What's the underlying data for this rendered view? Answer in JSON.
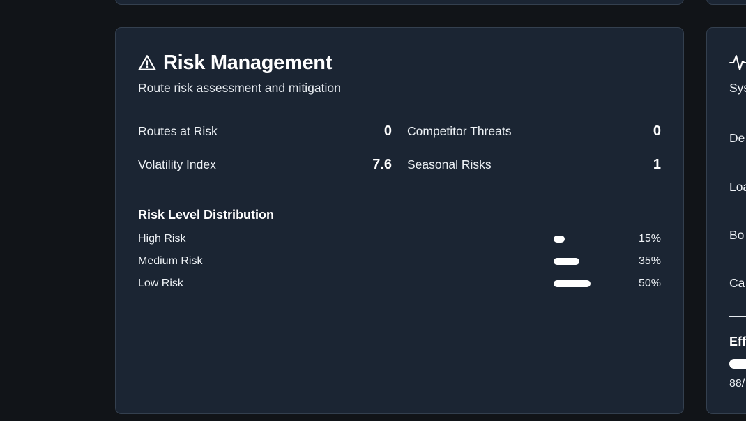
{
  "risk_card": {
    "title": "Risk Management",
    "icon": "warning-triangle-icon",
    "subtitle": "Route risk assessment and mitigation",
    "metrics": [
      {
        "label": "Routes at Risk",
        "value": "0"
      },
      {
        "label": "Competitor Threats",
        "value": "0"
      },
      {
        "label": "Volatility Index",
        "value": "7.6"
      },
      {
        "label": "Seasonal Risks",
        "value": "1"
      }
    ],
    "distribution": {
      "title": "Risk Level Distribution",
      "items": [
        {
          "label": "High Risk",
          "percent": "15%",
          "fraction": 0.15
        },
        {
          "label": "Medium Risk",
          "percent": "35%",
          "fraction": 0.35
        },
        {
          "label": "Low Risk",
          "percent": "50%",
          "fraction": 0.5
        }
      ]
    }
  },
  "system_card": {
    "icon": "activity-pulse-icon",
    "subtitle_partial": "Sys",
    "lines_partial": [
      "De",
      "Loa",
      "Bo",
      "Ca"
    ],
    "section_partial": "Eff",
    "footer_partial": "88/"
  },
  "colors": {
    "background": "#111418",
    "card": "#1b2533",
    "border": "#34404f",
    "text": "#ffffff"
  }
}
